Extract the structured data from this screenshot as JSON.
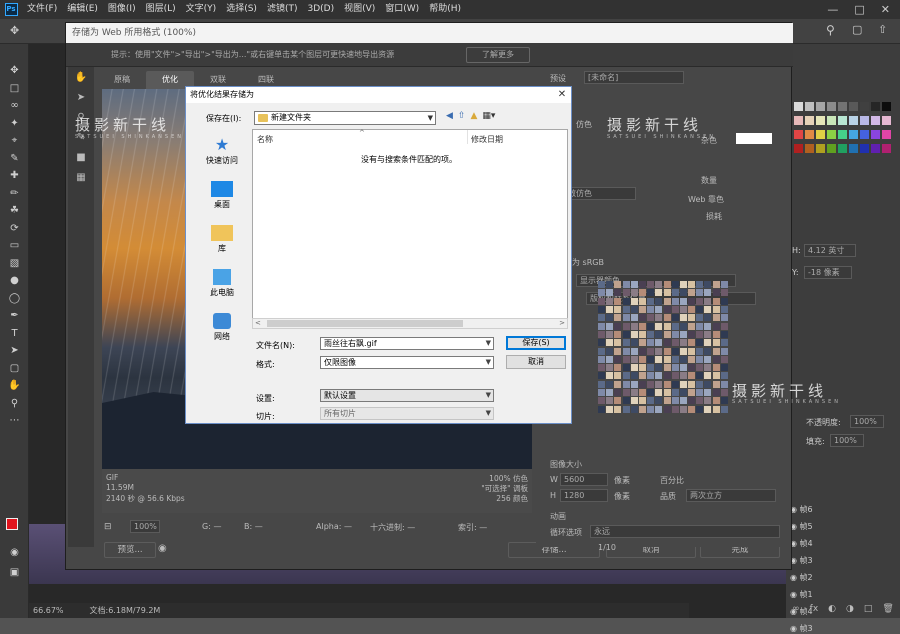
{
  "menubar": {
    "logo": "Ps",
    "items": [
      "文件(F)",
      "编辑(E)",
      "图像(I)",
      "图层(L)",
      "文字(Y)",
      "选择(S)",
      "滤镜(T)",
      "3D(D)",
      "视图(V)",
      "窗口(W)",
      "帮助(H)"
    ]
  },
  "status": {
    "zoom": "66.67%",
    "doc": "文档:6.18M/79.2M"
  },
  "sfw": {
    "title": "存储为 Web 所用格式 (100%)",
    "info": "提示：使用\"文件\">\"导出\">\"导出为...\"或右键单击某个图层可更快速地导出资源",
    "learn_more": "了解更多",
    "tabs": [
      "原稿",
      "优化",
      "双联",
      "四联"
    ],
    "stats_left": [
      "GIF",
      "11.59M",
      "2140 秒 @ 56.6 Kbps"
    ],
    "stats_right": [
      "100% 仿色",
      "\"可选择\" 调板",
      "256 颜色"
    ],
    "bottom_zoom": "100%",
    "bottom_g": "G: —",
    "bottom_b": "B: —",
    "bottom_alpha": "Alpha: —",
    "bottom_hex": "十六进制: —",
    "bottom_index": "索引: —",
    "preview_btn": "预览...",
    "save_btn": "存储...",
    "cancel_btn": "取消",
    "done_btn": "完成",
    "settings": {
      "preset_label": "预设",
      "preset_value": "[未命名]",
      "dither_label": "仿色",
      "matte_label": "杂色",
      "amount_label": "数量",
      "web_label": "Web 靠色",
      "lossy_label": "损耗",
      "dither_algo": "扩散仿色",
      "convert_srgb": "转换为 sRGB",
      "display_color": "显示器颜色",
      "metadata": "版权和联系信息",
      "image_size": "图像大小",
      "w_label": "W",
      "w_value": "5600",
      "h_label": "H",
      "h_value": "1280",
      "px": "像素",
      "percent_label": "百分比",
      "quality_label": "品质",
      "quality_value": "两次立方",
      "anim_label": "动画",
      "loop_label": "循环选项",
      "loop_value": "永远",
      "frame": "1/10"
    }
  },
  "watermark": {
    "text": "摄影新干线",
    "sub": "SATSUEI SHINKANSEN"
  },
  "dialog": {
    "title": "将优化结果存储为",
    "save_in_label": "保存在(I):",
    "save_in_value": "新建文件夹",
    "places": [
      "快速访问",
      "桌面",
      "库",
      "此电脑",
      "网络"
    ],
    "col_name": "名称",
    "col_date": "修改日期",
    "empty_text": "没有与搜索条件匹配的项。",
    "filename_label": "文件名(N):",
    "filename_value": "雨丝往右飘.gif",
    "format_label": "格式:",
    "format_value": "仅限图像",
    "settings_label": "设置:",
    "settings_value": "默认设置",
    "slices_label": "切片:",
    "slices_value": "所有切片",
    "save_btn": "保存(S)",
    "cancel_btn": "取消"
  },
  "rightpanel": {
    "h_label": "H:",
    "h_value": "4.12 英寸",
    "y_label": "Y:",
    "y_value": "-18 像素",
    "opacity_label": "不透明度:",
    "opacity_value": "100%",
    "fill_label": "填充:",
    "fill_value": "100%",
    "layers": [
      "帧6",
      "帧5",
      "帧4",
      "帧3",
      "帧2",
      "帧1",
      "帧4",
      "帧3"
    ]
  },
  "colors": {
    "accent": "#0078d7",
    "ps_blue": "#31a8ff",
    "fg_color": "#e0141d"
  }
}
